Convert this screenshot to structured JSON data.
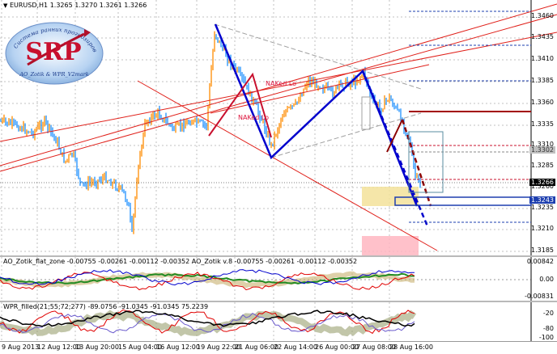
{
  "chart": {
    "symbol_info": "EURUSD,H1  1.3265 1.3270 1.3261 1.3266",
    "symbol_icon": "triangle-down-icon",
    "current_price": "1.3266",
    "price_tag_1": "1.3302",
    "price_tag_2": "1.3243",
    "annotations": [
      "NAKed Lo",
      "NAKed Lo"
    ]
  },
  "logo": {
    "main": "SRP",
    "arc_text": "Система ранних прогнозирования",
    "sub1": "AO_Zotik & WPR_V2mark"
  },
  "indicator1": {
    "label": "AO_Zotik_flat_zone -0.00755 -0.00261 -0.00112 -0.00352  AO_Zotik v.8 -0.00755 -0.00261 -0.00112 -0.00352"
  },
  "indicator2": {
    "label": "WPR_filled(21;55;72;277) -89.0756 -91.0345 -91.0345 75.2239"
  },
  "price_axis": [
    "1.3460",
    "1.3435",
    "1.3410",
    "1.3385",
    "1.3360",
    "1.3335",
    "1.3310",
    "1.3285",
    "1.3260",
    "1.3235",
    "1.3210",
    "1.3185"
  ],
  "ind1_axis": [
    "0.00842",
    "0.00",
    "-0.00831"
  ],
  "ind2_axis": [
    "-20",
    "-80",
    "-100"
  ],
  "time_axis": [
    "9 Aug 2013",
    "12 Aug 12:00",
    "13 Aug 20:00",
    "15 Aug 04:00",
    "16 Aug 12:00",
    "19 Aug 22:00",
    "21 Aug 06:00",
    "22 Aug 14:00",
    "26 Aug 00:00",
    "27 Aug 08:00",
    "28 Aug 16:00"
  ],
  "colors": {
    "bull": "#ff8c00",
    "bear": "#1e90ff",
    "blue_line": "#0000cd",
    "red_line": "#dc143c",
    "dark_red": "#8b0000",
    "grid": "#c0c0c0"
  }
}
